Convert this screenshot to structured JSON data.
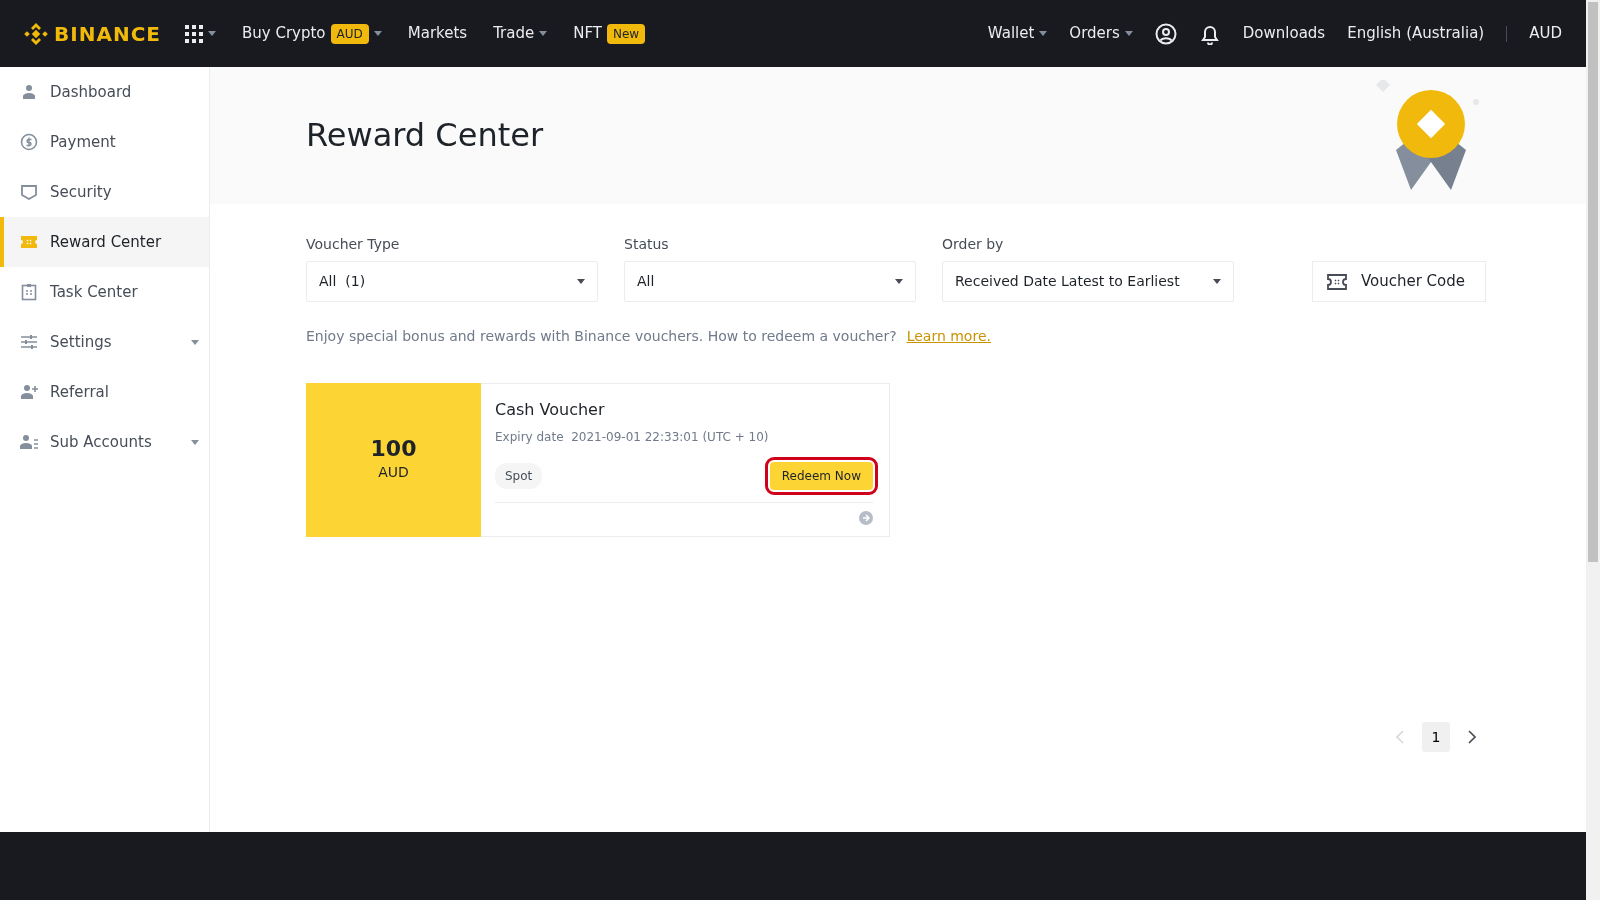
{
  "navbar": {
    "logo": "BINANCE",
    "left_items": [
      {
        "kind": "apps",
        "caret": true
      },
      {
        "kind": "link",
        "label": "Buy Crypto",
        "badge": "AUD",
        "caret": true
      },
      {
        "kind": "link",
        "label": "Markets",
        "caret": false
      },
      {
        "kind": "link",
        "label": "Trade",
        "caret": true
      },
      {
        "kind": "link",
        "label": "NFT",
        "badge": "New",
        "caret": false
      }
    ],
    "right_items": [
      {
        "kind": "link",
        "label": "Wallet",
        "caret": true
      },
      {
        "kind": "link",
        "label": "Orders",
        "caret": true
      },
      {
        "kind": "account"
      },
      {
        "kind": "notifications"
      },
      {
        "kind": "link",
        "label": "Downloads",
        "caret": false
      },
      {
        "kind": "link",
        "label": "English (Australia)",
        "caret": false
      },
      {
        "kind": "divider"
      },
      {
        "kind": "link",
        "label": "AUD",
        "caret": false
      }
    ]
  },
  "sidebar": {
    "items": [
      {
        "label": "Dashboard",
        "selected": false,
        "expandable": false
      },
      {
        "label": "Payment",
        "selected": false,
        "expandable": false
      },
      {
        "label": "Security",
        "selected": false,
        "expandable": false
      },
      {
        "label": "Reward Center",
        "selected": true,
        "expandable": false
      },
      {
        "label": "Task Center",
        "selected": false,
        "expandable": false
      },
      {
        "label": "Settings",
        "selected": false,
        "expandable": true
      },
      {
        "label": "Referral",
        "selected": false,
        "expandable": false
      },
      {
        "label": "Sub Accounts",
        "selected": false,
        "expandable": true
      }
    ]
  },
  "page": {
    "title": "Reward Center",
    "filters": [
      {
        "label": "Voucher Type",
        "value": "All  (1)"
      },
      {
        "label": "Status",
        "value": "All"
      },
      {
        "label": "Order by",
        "value": "Received Date Latest to Earliest"
      }
    ],
    "voucher_code_button": "Voucher Code",
    "info": {
      "text": "Enjoy special bonus and rewards with Binance vouchers. How to redeem a voucher?",
      "link": "Learn more."
    },
    "vouchers": [
      {
        "amount": "100",
        "currency": "AUD",
        "title": "Cash Voucher",
        "expiry_label": "Expiry date",
        "expiry": "2021-09-01 22:33:01 (UTC + 10)",
        "tag": "Spot",
        "button": {
          "label": "Redeem Now",
          "highlighted": true
        }
      }
    ],
    "pagination": {
      "previous": {
        "disabled": true
      },
      "pages": [
        {
          "label": "1",
          "selected": true
        }
      ],
      "next": {
        "disabled": false
      }
    }
  }
}
